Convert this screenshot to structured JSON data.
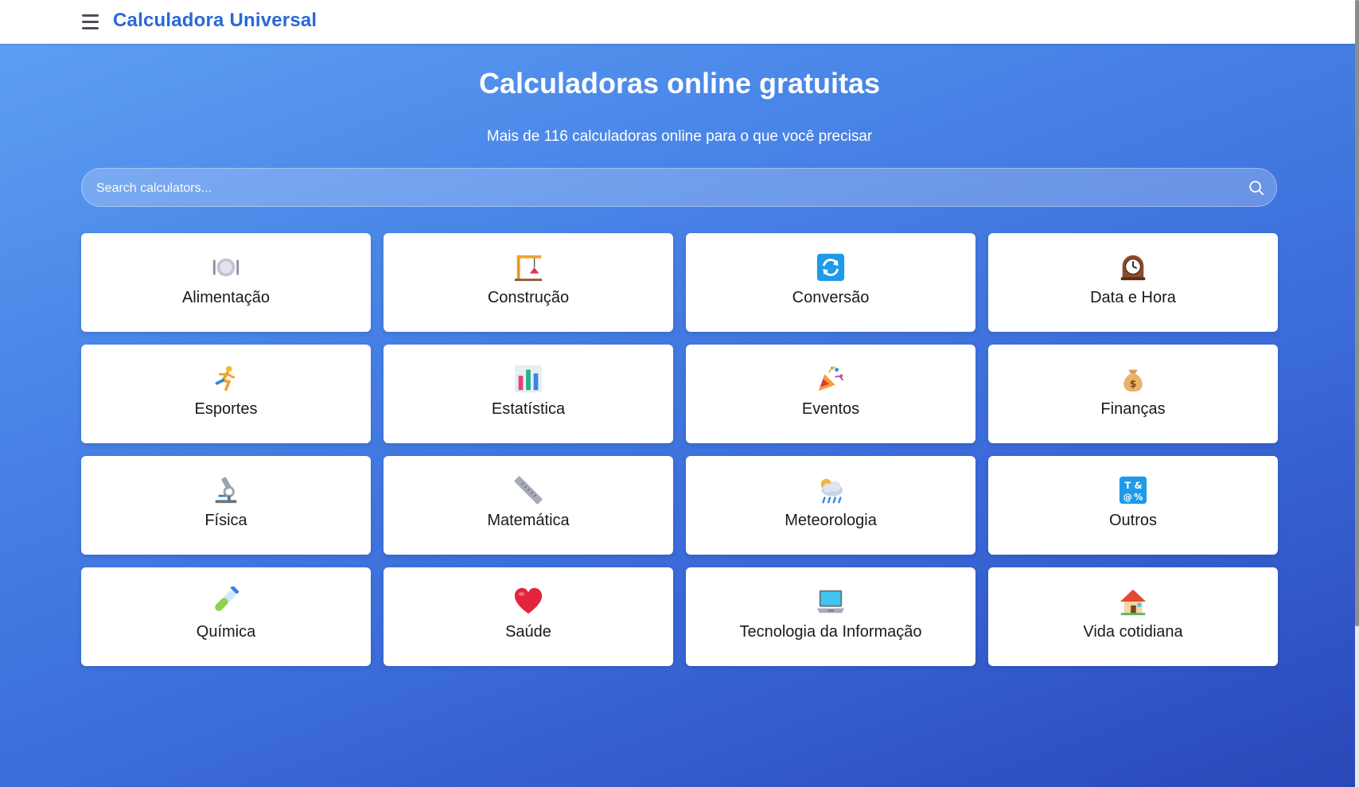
{
  "header": {
    "brand": "Calculadora Universal"
  },
  "hero": {
    "title": "Calculadoras online gratuitas",
    "subtitle": "Mais de 116 calculadoras online para o que você precisar"
  },
  "search": {
    "placeholder": "Search calculators..."
  },
  "categories": [
    {
      "label": "Alimentação",
      "icon": "plate-icon"
    },
    {
      "label": "Construção",
      "icon": "crane-icon"
    },
    {
      "label": "Conversão",
      "icon": "conversion-icon"
    },
    {
      "label": "Data e Hora",
      "icon": "clock-icon"
    },
    {
      "label": "Esportes",
      "icon": "runner-icon"
    },
    {
      "label": "Estatística",
      "icon": "bar-chart-icon"
    },
    {
      "label": "Eventos",
      "icon": "party-popper-icon"
    },
    {
      "label": "Finanças",
      "icon": "money-bag-icon"
    },
    {
      "label": "Física",
      "icon": "microscope-icon"
    },
    {
      "label": "Matemática",
      "icon": "ruler-icon"
    },
    {
      "label": "Meteorologia",
      "icon": "rain-cloud-icon"
    },
    {
      "label": "Outros",
      "icon": "symbols-icon"
    },
    {
      "label": "Química",
      "icon": "test-tube-icon"
    },
    {
      "label": "Saúde",
      "icon": "heart-icon"
    },
    {
      "label": "Tecnologia da Informação",
      "icon": "laptop-icon"
    },
    {
      "label": "Vida cotidiana",
      "icon": "house-icon"
    }
  ],
  "colors": {
    "brand": "#2a67d6",
    "gradient_start": "#5fa2f3",
    "gradient_end": "#2a47b8"
  }
}
